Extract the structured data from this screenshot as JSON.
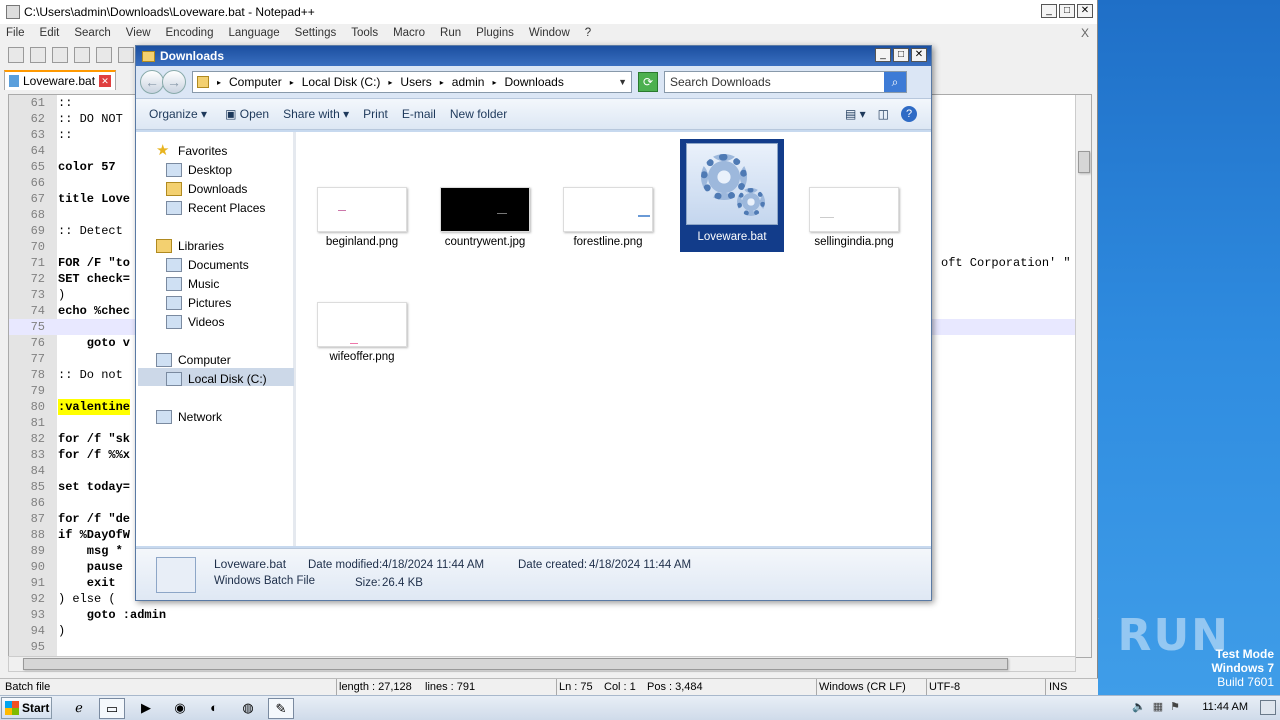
{
  "npp": {
    "title": "C:\\Users\\admin\\Downloads\\Loveware.bat - Notepad++",
    "menu": [
      "File",
      "Edit",
      "Search",
      "View",
      "Encoding",
      "Language",
      "Settings",
      "Tools",
      "Macro",
      "Run",
      "Plugins",
      "Window",
      "?"
    ],
    "close_x": "X",
    "tab_label": "Loveware.bat",
    "lines": [
      {
        "num": "61",
        "code": "::"
      },
      {
        "num": "62",
        "code": ":: DO NOT"
      },
      {
        "num": "63",
        "code": "::"
      },
      {
        "num": "64",
        "code": ""
      },
      {
        "num": "65",
        "code": "color 57"
      },
      {
        "num": "66",
        "code": ""
      },
      {
        "num": "67",
        "code": "title Love"
      },
      {
        "num": "68",
        "code": ""
      },
      {
        "num": "69",
        "code": ":: Detect"
      },
      {
        "num": "70",
        "code": ""
      },
      {
        "num": "71",
        "code": "FOR /F \"to",
        "right": "oft Corporation' \""
      },
      {
        "num": "72",
        "code": "SET check="
      },
      {
        "num": "73",
        "code": ")"
      },
      {
        "num": "74",
        "code": "echo %chec"
      },
      {
        "num": "75",
        "code": ""
      },
      {
        "num": "76",
        "code": "    goto v"
      },
      {
        "num": "77",
        "code": ""
      },
      {
        "num": "78",
        "code": ":: Do not"
      },
      {
        "num": "79",
        "code": ""
      },
      {
        "num": "80",
        "code": ":valentine"
      },
      {
        "num": "81",
        "code": ""
      },
      {
        "num": "82",
        "code": "for /f \"sk"
      },
      {
        "num": "83",
        "code": "for /f %%x"
      },
      {
        "num": "84",
        "code": ""
      },
      {
        "num": "85",
        "code": "set today="
      },
      {
        "num": "86",
        "code": ""
      },
      {
        "num": "87",
        "code": "for /f \"de"
      },
      {
        "num": "88",
        "code": "if %DayOfW"
      },
      {
        "num": "89",
        "code": "    msg *"
      },
      {
        "num": "90",
        "code": "    pause"
      },
      {
        "num": "91",
        "code": "    exit"
      },
      {
        "num": "92",
        "code": ") else ("
      },
      {
        "num": "93",
        "code": "    goto :admin"
      },
      {
        "num": "94",
        "code": ")"
      },
      {
        "num": "95",
        "code": ""
      }
    ],
    "status": {
      "lang": "Batch file",
      "length": "length : 27,128",
      "lines": "lines : 791",
      "ln": "Ln : 75",
      "col": "Col : 1",
      "pos": "Pos : 3,484",
      "eol": "Windows (CR LF)",
      "enc": "UTF-8",
      "ins": "INS"
    }
  },
  "explorer": {
    "title": "Downloads",
    "breadcrumb": [
      "Computer",
      "Local Disk (C:)",
      "Users",
      "admin",
      "Downloads"
    ],
    "search_placeholder": "Search Downloads",
    "commands": {
      "organize": "Organize",
      "open": "Open",
      "share": "Share with",
      "print": "Print",
      "email": "E-mail",
      "new_folder": "New folder"
    },
    "nav": {
      "favorites": "Favorites",
      "desktop": "Desktop",
      "downloads": "Downloads",
      "recent": "Recent Places",
      "libraries": "Libraries",
      "documents": "Documents",
      "music": "Music",
      "pictures": "Pictures",
      "videos": "Videos",
      "computer": "Computer",
      "localdisk": "Local Disk (C:)",
      "network": "Network"
    },
    "files": [
      {
        "name": "beginland.png"
      },
      {
        "name": "countrywent.jpg"
      },
      {
        "name": "forestline.png"
      },
      {
        "name": "Loveware.bat"
      },
      {
        "name": "sellingindia.png"
      },
      {
        "name": "wifeoffer.png"
      }
    ],
    "details": {
      "name": "Loveware.bat",
      "type": "Windows Batch File",
      "modified_label": "Date modified:",
      "modified": "4/18/2024 11:44 AM",
      "created_label": "Date created:",
      "created": "4/18/2024 11:44 AM",
      "size_label": "Size:",
      "size": "26.4 KB"
    }
  },
  "taskbar": {
    "start": "Start",
    "clock": "11:44 AM"
  },
  "desktop": {
    "watermark": "ANY RUN",
    "testmode": "Test Mode",
    "os": "Windows 7",
    "build": "Build 7601"
  }
}
